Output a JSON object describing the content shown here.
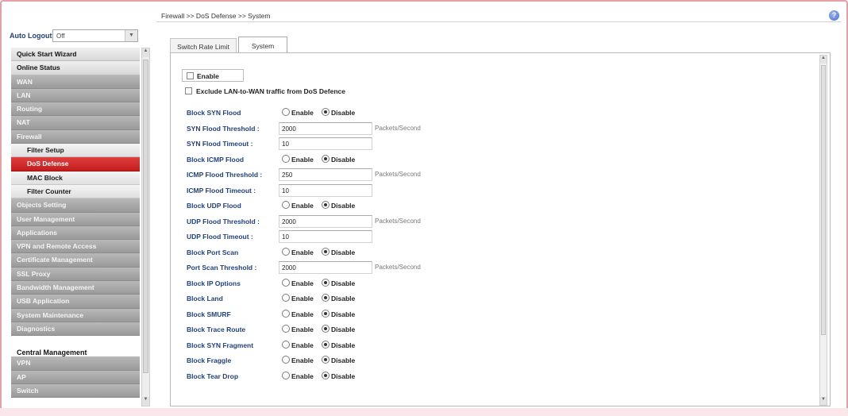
{
  "breadcrumb": "Firewall >> DoS Defense >> System",
  "auto_logout": {
    "label": "Auto Logout :",
    "value": "Off"
  },
  "sidebar": {
    "items": [
      {
        "label": "Quick Start Wizard",
        "style": "light"
      },
      {
        "label": "Online Status",
        "style": "light"
      },
      {
        "label": "WAN",
        "style": "dark"
      },
      {
        "label": "LAN",
        "style": "dark"
      },
      {
        "label": "Routing",
        "style": "dark"
      },
      {
        "label": "NAT",
        "style": "dark"
      },
      {
        "label": "Firewall",
        "style": "dark"
      },
      {
        "label": "Filter Setup",
        "style": "sub"
      },
      {
        "label": "DoS Defense",
        "style": "active"
      },
      {
        "label": "MAC Block",
        "style": "sub"
      },
      {
        "label": "Filter Counter",
        "style": "sub"
      },
      {
        "label": "Objects Setting",
        "style": "dark"
      },
      {
        "label": "User Management",
        "style": "dark"
      },
      {
        "label": "Applications",
        "style": "dark"
      },
      {
        "label": "VPN and Remote Access",
        "style": "dark"
      },
      {
        "label": "Certificate Management",
        "style": "dark"
      },
      {
        "label": "SSL Proxy",
        "style": "dark"
      },
      {
        "label": "Bandwidth Management",
        "style": "dark"
      },
      {
        "label": "USB Application",
        "style": "dark"
      },
      {
        "label": "System Maintenance",
        "style": "dark"
      },
      {
        "label": "Diagnostics",
        "style": "dark"
      },
      {
        "label": "",
        "style": "gap"
      },
      {
        "label": "Central Management",
        "style": "plain"
      },
      {
        "label": "VPN",
        "style": "dark"
      },
      {
        "label": "AP",
        "style": "dark"
      },
      {
        "label": "Switch",
        "style": "dark"
      }
    ]
  },
  "tabs": [
    "Switch Rate Limit",
    "System"
  ],
  "enable_label": "Enable",
  "exclude_label": "Exclude LAN-to-WAN traffic from DoS Defence",
  "radio": {
    "enable": "Enable",
    "disable": "Disable"
  },
  "rows": [
    {
      "type": "radio",
      "label": "Block SYN Flood",
      "selected": "disable"
    },
    {
      "type": "field",
      "label": "SYN Flood Threshold :",
      "value": "2000",
      "unit": "Packets/Second"
    },
    {
      "type": "field",
      "label": "SYN Flood Timeout :",
      "value": "10",
      "unit": ""
    },
    {
      "type": "radio",
      "label": "Block ICMP Flood",
      "selected": "disable"
    },
    {
      "type": "field",
      "label": "ICMP Flood Threshold :",
      "value": "250",
      "unit": "Packets/Second"
    },
    {
      "type": "field",
      "label": "ICMP Flood Timeout :",
      "value": "10",
      "unit": ""
    },
    {
      "type": "radio",
      "label": "Block UDP Flood",
      "selected": "disable"
    },
    {
      "type": "field",
      "label": "UDP Flood Threshold :",
      "value": "2000",
      "unit": "Packets/Second"
    },
    {
      "type": "field",
      "label": "UDP Flood Timeout :",
      "value": "10",
      "unit": ""
    },
    {
      "type": "radio",
      "label": "Block Port Scan",
      "selected": "disable"
    },
    {
      "type": "field",
      "label": "Port Scan Threshold :",
      "value": "2000",
      "unit": "Packets/Second"
    },
    {
      "type": "radio",
      "label": "Block IP Options",
      "selected": "disable"
    },
    {
      "type": "radio",
      "label": "Block Land",
      "selected": "disable"
    },
    {
      "type": "radio",
      "label": "Block SMURF",
      "selected": "disable"
    },
    {
      "type": "radio",
      "label": "Block Trace Route",
      "selected": "disable"
    },
    {
      "type": "radio",
      "label": "Block SYN Fragment",
      "selected": "disable"
    },
    {
      "type": "radio",
      "label": "Block Fraggle",
      "selected": "disable"
    },
    {
      "type": "radio",
      "label": "Block Tear Drop",
      "selected": "disable"
    }
  ]
}
